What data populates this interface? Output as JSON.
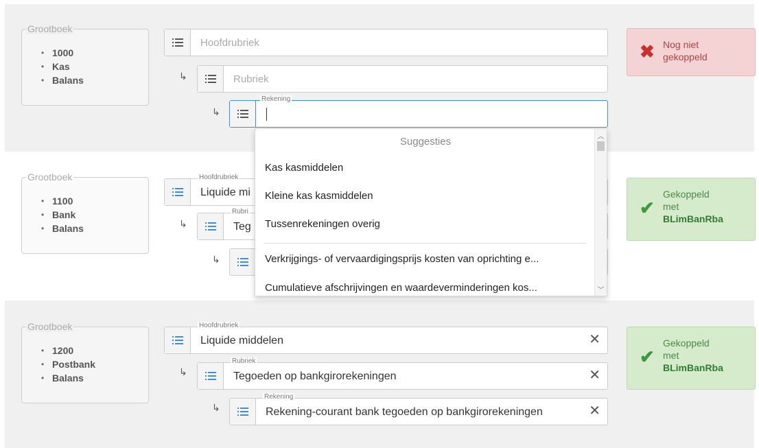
{
  "rows": [
    {
      "ledger": {
        "title": "Grootboek",
        "items": [
          "1000",
          "Kas",
          "Balans"
        ]
      },
      "hoofdrubriek": {
        "label": "",
        "value": "",
        "placeholder": "Hoofdrubriek"
      },
      "rubriek": {
        "label": "",
        "value": "",
        "placeholder": "Rubriek"
      },
      "rekening": {
        "label": "Rekening",
        "value": ""
      },
      "status": {
        "state": "error",
        "icon": "cross-icon",
        "line1": "Nog niet",
        "line2": "gekoppeld"
      }
    },
    {
      "ledger": {
        "title": "Grootboek",
        "items": [
          "1100",
          "Bank",
          "Balans"
        ]
      },
      "hoofdrubriek": {
        "label": "Hoofdrubriek",
        "value": "Liquide mi"
      },
      "rubriek": {
        "label": "Rubri",
        "value": "Teg"
      },
      "status": {
        "state": "success",
        "icon": "check-icon",
        "line1": "Gekoppeld",
        "line2": "met",
        "code": "BLimBanRba"
      }
    },
    {
      "ledger": {
        "title": "Grootboek",
        "items": [
          "1200",
          "Postbank",
          "Balans"
        ]
      },
      "hoofdrubriek": {
        "label": "Hoofdrubriek",
        "value": "Liquide middelen"
      },
      "rubriek": {
        "label": "Rubriek",
        "value": "Tegoeden op bankgirorekeningen"
      },
      "rekening": {
        "label": "Rekening",
        "value": "Rekening-courant bank tegoeden op bankgirorekeningen"
      },
      "status": {
        "state": "success",
        "icon": "check-icon",
        "line1": "Gekoppeld",
        "line2": "met",
        "code": "BLimBanRba"
      }
    }
  ],
  "dropdown": {
    "header": "Suggesties",
    "items": [
      "Kas kasmiddelen",
      "Kleine kas kasmiddelen",
      "Tussenrekeningen overig",
      "Verkrijgings- of vervaardigingsprijs kosten van oprichting e...",
      "Cumulatieve afschrijvingen en waardeverminderingen kos..."
    ]
  },
  "colors": {
    "accent": "#3a8fd6",
    "error_bg": "#f3d3d4",
    "success_bg": "#d5ebcc",
    "row_bg": "#f0f0f0"
  }
}
